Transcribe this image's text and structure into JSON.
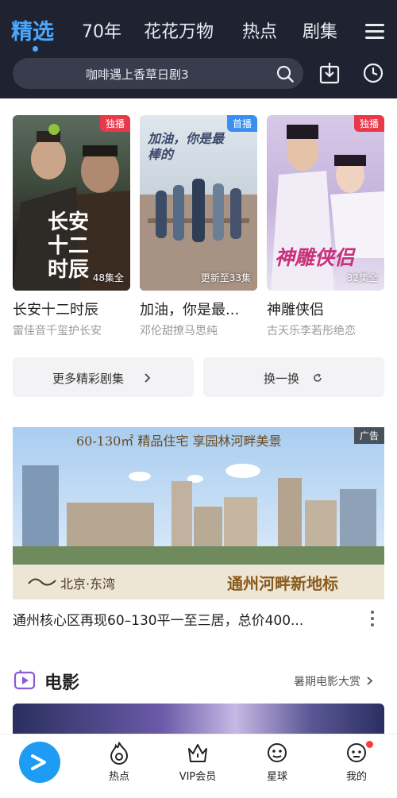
{
  "header": {
    "tabs": [
      {
        "label": "精选",
        "active": true
      },
      {
        "label": "70年"
      },
      {
        "label": "花花万物"
      },
      {
        "label": "热点"
      },
      {
        "label": "剧集"
      }
    ],
    "search_text": "咖啡遇上香草日剧3",
    "icons": [
      "menu-icon",
      "search-icon",
      "download-icon",
      "history-icon"
    ]
  },
  "dramas": [
    {
      "badge": "独播",
      "badge_color": "#e8394a",
      "count": "48集全",
      "poster_title": "长安十二时辰",
      "title": "长安十二时辰",
      "subtitle": "雷佳音千玺护长安"
    },
    {
      "badge": "首播",
      "badge_color": "#3a8ef0",
      "count": "更新至33集",
      "poster_title": "加油，你是最棒的",
      "title": "加油，你是最...",
      "subtitle": "邓伦甜撩马思纯"
    },
    {
      "badge": "独播",
      "badge_color": "#e8394a",
      "count": "32集全",
      "poster_title": "神雕侠侣",
      "title": "神雕侠侣",
      "subtitle": "古天乐李若彤绝恋"
    }
  ],
  "buttons": {
    "more": "更多精彩剧集",
    "refresh": "换一换"
  },
  "ad": {
    "tag": "广告",
    "headline": "60-130㎡ 精品住宅 享园林河畔美景",
    "brand": "北京·东湾",
    "slogan": "通州河畔新地标",
    "title": "通州核心区再现60–130平一至三居，总价400..."
  },
  "movies": {
    "section_title": "电影",
    "more": "暑期电影大赏"
  },
  "bottom_nav": {
    "items": [
      {
        "label": "热点",
        "icon": "flame-icon"
      },
      {
        "label": "VIP会员",
        "icon": "crown-icon"
      },
      {
        "label": "星球",
        "icon": "planet-icon"
      },
      {
        "label": "我的",
        "icon": "profile-icon"
      }
    ]
  },
  "colors": {
    "header_bg": "#1f2230",
    "accent": "#4aa8ff",
    "play_button": "#1e9bf3"
  }
}
